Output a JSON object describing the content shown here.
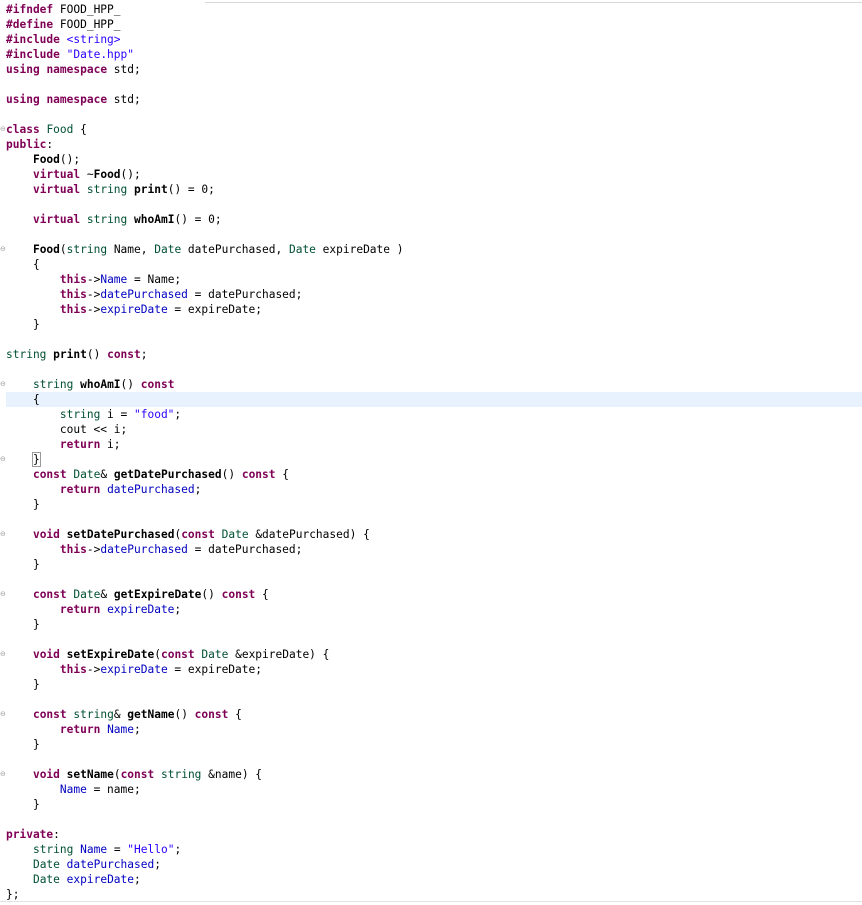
{
  "editor": {
    "lines": [
      [
        {
          "t": "#ifndef",
          "c": "key"
        },
        {
          "t": " FOOD_HPP_",
          "c": "plain"
        }
      ],
      [
        {
          "t": "#define",
          "c": "key"
        },
        {
          "t": " FOOD_HPP_",
          "c": "plain"
        }
      ],
      [
        {
          "t": "#include",
          "c": "key"
        },
        {
          "t": " ",
          "c": "plain"
        },
        {
          "t": "<string>",
          "c": "str"
        }
      ],
      [
        {
          "t": "#include",
          "c": "key"
        },
        {
          "t": " ",
          "c": "plain"
        },
        {
          "t": "\"Date.hpp\"",
          "c": "str"
        }
      ],
      [
        {
          "t": "using",
          "c": "key"
        },
        {
          "t": " ",
          "c": "plain"
        },
        {
          "t": "namespace",
          "c": "key"
        },
        {
          "t": " std;",
          "c": "plain"
        }
      ],
      [],
      [
        {
          "t": "using",
          "c": "key"
        },
        {
          "t": " ",
          "c": "plain"
        },
        {
          "t": "namespace",
          "c": "key"
        },
        {
          "t": " std;",
          "c": "plain"
        }
      ],
      [],
      [
        {
          "t": "class",
          "c": "key"
        },
        {
          "t": " ",
          "c": "plain"
        },
        {
          "t": "Food",
          "c": "type"
        },
        {
          "t": " {",
          "c": "plain"
        }
      ],
      [
        {
          "t": "public",
          "c": "key"
        },
        {
          "t": ":",
          "c": "plain"
        }
      ],
      [
        {
          "t": "    ",
          "c": "plain"
        },
        {
          "t": "Food",
          "c": "fn"
        },
        {
          "t": "();",
          "c": "plain"
        }
      ],
      [
        {
          "t": "    ",
          "c": "plain"
        },
        {
          "t": "virtual",
          "c": "key"
        },
        {
          "t": " ~",
          "c": "plain"
        },
        {
          "t": "Food",
          "c": "fn"
        },
        {
          "t": "();",
          "c": "plain"
        }
      ],
      [
        {
          "t": "    ",
          "c": "plain"
        },
        {
          "t": "virtual",
          "c": "key"
        },
        {
          "t": " ",
          "c": "plain"
        },
        {
          "t": "string",
          "c": "type"
        },
        {
          "t": " ",
          "c": "plain"
        },
        {
          "t": "print",
          "c": "fn"
        },
        {
          "t": "() = 0;",
          "c": "plain"
        }
      ],
      [],
      [
        {
          "t": "    ",
          "c": "plain"
        },
        {
          "t": "virtual",
          "c": "key"
        },
        {
          "t": " ",
          "c": "plain"
        },
        {
          "t": "string",
          "c": "type"
        },
        {
          "t": " ",
          "c": "plain"
        },
        {
          "t": "whoAmI",
          "c": "fn"
        },
        {
          "t": "() = 0;",
          "c": "plain"
        }
      ],
      [],
      [
        {
          "t": "    ",
          "c": "plain"
        },
        {
          "t": "Food",
          "c": "fn"
        },
        {
          "t": "(",
          "c": "plain"
        },
        {
          "t": "string",
          "c": "type"
        },
        {
          "t": " Name, ",
          "c": "plain"
        },
        {
          "t": "Date",
          "c": "type"
        },
        {
          "t": " datePurchased, ",
          "c": "plain"
        },
        {
          "t": "Date",
          "c": "type"
        },
        {
          "t": " expireDate )",
          "c": "plain"
        }
      ],
      [
        {
          "t": "    {",
          "c": "plain"
        }
      ],
      [
        {
          "t": "        ",
          "c": "plain"
        },
        {
          "t": "this",
          "c": "key"
        },
        {
          "t": "->",
          "c": "plain"
        },
        {
          "t": "Name",
          "c": "field"
        },
        {
          "t": " = Name;",
          "c": "plain"
        }
      ],
      [
        {
          "t": "        ",
          "c": "plain"
        },
        {
          "t": "this",
          "c": "key"
        },
        {
          "t": "->",
          "c": "plain"
        },
        {
          "t": "datePurchased",
          "c": "field"
        },
        {
          "t": " = datePurchased;",
          "c": "plain"
        }
      ],
      [
        {
          "t": "        ",
          "c": "plain"
        },
        {
          "t": "this",
          "c": "key"
        },
        {
          "t": "->",
          "c": "plain"
        },
        {
          "t": "expireDate",
          "c": "field"
        },
        {
          "t": " = expireDate;",
          "c": "plain"
        }
      ],
      [
        {
          "t": "    }",
          "c": "plain"
        }
      ],
      [],
      [
        {
          "t": "string",
          "c": "type"
        },
        {
          "t": " ",
          "c": "plain"
        },
        {
          "t": "print",
          "c": "fn"
        },
        {
          "t": "() ",
          "c": "plain"
        },
        {
          "t": "const",
          "c": "key"
        },
        {
          "t": ";",
          "c": "plain"
        }
      ],
      [],
      [
        {
          "t": "    ",
          "c": "plain"
        },
        {
          "t": "string",
          "c": "type"
        },
        {
          "t": " ",
          "c": "plain"
        },
        {
          "t": "whoAmI",
          "c": "fn"
        },
        {
          "t": "() ",
          "c": "plain"
        },
        {
          "t": "const",
          "c": "key"
        }
      ],
      [
        {
          "t": "    {",
          "c": "plain"
        }
      ],
      [
        {
          "t": "        ",
          "c": "plain"
        },
        {
          "t": "string",
          "c": "type"
        },
        {
          "t": " i = ",
          "c": "plain"
        },
        {
          "t": "\"food\"",
          "c": "str"
        },
        {
          "t": ";",
          "c": "plain"
        }
      ],
      [
        {
          "t": "        cout << i;",
          "c": "plain"
        }
      ],
      [
        {
          "t": "        ",
          "c": "plain"
        },
        {
          "t": "return",
          "c": "key"
        },
        {
          "t": " i;",
          "c": "plain"
        }
      ],
      [
        {
          "t": "    ",
          "c": "plain"
        },
        {
          "t": "}",
          "c": "caret"
        }
      ],
      [
        {
          "t": "    ",
          "c": "plain"
        },
        {
          "t": "const",
          "c": "key"
        },
        {
          "t": " ",
          "c": "plain"
        },
        {
          "t": "Date",
          "c": "type"
        },
        {
          "t": "& ",
          "c": "plain"
        },
        {
          "t": "getDatePurchased",
          "c": "fn"
        },
        {
          "t": "() ",
          "c": "plain"
        },
        {
          "t": "const",
          "c": "key"
        },
        {
          "t": " {",
          "c": "plain"
        }
      ],
      [
        {
          "t": "        ",
          "c": "plain"
        },
        {
          "t": "return",
          "c": "key"
        },
        {
          "t": " ",
          "c": "plain"
        },
        {
          "t": "datePurchased",
          "c": "field"
        },
        {
          "t": ";",
          "c": "plain"
        }
      ],
      [
        {
          "t": "    }",
          "c": "plain"
        }
      ],
      [],
      [
        {
          "t": "    ",
          "c": "plain"
        },
        {
          "t": "void",
          "c": "key"
        },
        {
          "t": " ",
          "c": "plain"
        },
        {
          "t": "setDatePurchased",
          "c": "fn"
        },
        {
          "t": "(",
          "c": "plain"
        },
        {
          "t": "const",
          "c": "key"
        },
        {
          "t": " ",
          "c": "plain"
        },
        {
          "t": "Date",
          "c": "type"
        },
        {
          "t": " &datePurchased) {",
          "c": "plain"
        }
      ],
      [
        {
          "t": "        ",
          "c": "plain"
        },
        {
          "t": "this",
          "c": "key"
        },
        {
          "t": "->",
          "c": "plain"
        },
        {
          "t": "datePurchased",
          "c": "field"
        },
        {
          "t": " = datePurchased;",
          "c": "plain"
        }
      ],
      [
        {
          "t": "    }",
          "c": "plain"
        }
      ],
      [],
      [
        {
          "t": "    ",
          "c": "plain"
        },
        {
          "t": "const",
          "c": "key"
        },
        {
          "t": " ",
          "c": "plain"
        },
        {
          "t": "Date",
          "c": "type"
        },
        {
          "t": "& ",
          "c": "plain"
        },
        {
          "t": "getExpireDate",
          "c": "fn"
        },
        {
          "t": "() ",
          "c": "plain"
        },
        {
          "t": "const",
          "c": "key"
        },
        {
          "t": " {",
          "c": "plain"
        }
      ],
      [
        {
          "t": "        ",
          "c": "plain"
        },
        {
          "t": "return",
          "c": "key"
        },
        {
          "t": " ",
          "c": "plain"
        },
        {
          "t": "expireDate",
          "c": "field"
        },
        {
          "t": ";",
          "c": "plain"
        }
      ],
      [
        {
          "t": "    }",
          "c": "plain"
        }
      ],
      [],
      [
        {
          "t": "    ",
          "c": "plain"
        },
        {
          "t": "void",
          "c": "key"
        },
        {
          "t": " ",
          "c": "plain"
        },
        {
          "t": "setExpireDate",
          "c": "fn"
        },
        {
          "t": "(",
          "c": "plain"
        },
        {
          "t": "const",
          "c": "key"
        },
        {
          "t": " ",
          "c": "plain"
        },
        {
          "t": "Date",
          "c": "type"
        },
        {
          "t": " &expireDate) {",
          "c": "plain"
        }
      ],
      [
        {
          "t": "        ",
          "c": "plain"
        },
        {
          "t": "this",
          "c": "key"
        },
        {
          "t": "->",
          "c": "plain"
        },
        {
          "t": "expireDate",
          "c": "field"
        },
        {
          "t": " = expireDate;",
          "c": "plain"
        }
      ],
      [
        {
          "t": "    }",
          "c": "plain"
        }
      ],
      [],
      [
        {
          "t": "    ",
          "c": "plain"
        },
        {
          "t": "const",
          "c": "key"
        },
        {
          "t": " ",
          "c": "plain"
        },
        {
          "t": "string",
          "c": "type"
        },
        {
          "t": "& ",
          "c": "plain"
        },
        {
          "t": "getName",
          "c": "fn"
        },
        {
          "t": "() ",
          "c": "plain"
        },
        {
          "t": "const",
          "c": "key"
        },
        {
          "t": " {",
          "c": "plain"
        }
      ],
      [
        {
          "t": "        ",
          "c": "plain"
        },
        {
          "t": "return",
          "c": "key"
        },
        {
          "t": " ",
          "c": "plain"
        },
        {
          "t": "Name",
          "c": "field"
        },
        {
          "t": ";",
          "c": "plain"
        }
      ],
      [
        {
          "t": "    }",
          "c": "plain"
        }
      ],
      [],
      [
        {
          "t": "    ",
          "c": "plain"
        },
        {
          "t": "void",
          "c": "key"
        },
        {
          "t": " ",
          "c": "plain"
        },
        {
          "t": "setName",
          "c": "fn"
        },
        {
          "t": "(",
          "c": "plain"
        },
        {
          "t": "const",
          "c": "key"
        },
        {
          "t": " ",
          "c": "plain"
        },
        {
          "t": "string",
          "c": "type"
        },
        {
          "t": " &name) {",
          "c": "plain"
        }
      ],
      [
        {
          "t": "        ",
          "c": "plain"
        },
        {
          "t": "Name",
          "c": "field"
        },
        {
          "t": " = name;",
          "c": "plain"
        }
      ],
      [
        {
          "t": "    }",
          "c": "plain"
        }
      ],
      [],
      [
        {
          "t": "private",
          "c": "key"
        },
        {
          "t": ":",
          "c": "plain"
        }
      ],
      [
        {
          "t": "    ",
          "c": "plain"
        },
        {
          "t": "string",
          "c": "type"
        },
        {
          "t": " ",
          "c": "plain"
        },
        {
          "t": "Name",
          "c": "field"
        },
        {
          "t": " = ",
          "c": "plain"
        },
        {
          "t": "\"Hello\"",
          "c": "str"
        },
        {
          "t": ";",
          "c": "plain"
        }
      ],
      [
        {
          "t": "    ",
          "c": "plain"
        },
        {
          "t": "Date",
          "c": "type"
        },
        {
          "t": " ",
          "c": "plain"
        },
        {
          "t": "datePurchased",
          "c": "field"
        },
        {
          "t": ";",
          "c": "plain"
        }
      ],
      [
        {
          "t": "    ",
          "c": "plain"
        },
        {
          "t": "Date",
          "c": "type"
        },
        {
          "t": " ",
          "c": "plain"
        },
        {
          "t": "expireDate",
          "c": "field"
        },
        {
          "t": ";",
          "c": "plain"
        }
      ],
      [
        {
          "t": "};",
          "c": "plain"
        }
      ]
    ],
    "current_line": 26,
    "fold_markers": [
      8,
      16,
      25,
      30,
      35,
      39,
      43,
      47,
      51
    ],
    "colors": {
      "keyword": "#7f0055",
      "type": "#005032",
      "string": "#2a00ff",
      "field": "#0000c0",
      "current_line_bg": "#e8f2fe"
    }
  }
}
